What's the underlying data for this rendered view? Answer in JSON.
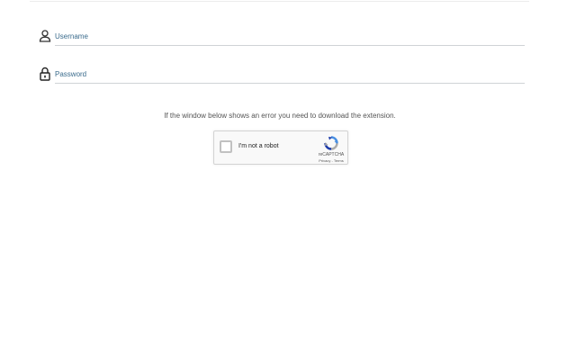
{
  "form": {
    "username": {
      "placeholder": "Username",
      "value": "",
      "icon": "user-icon"
    },
    "password": {
      "placeholder": "Password",
      "value": "",
      "icon": "lock-icon"
    }
  },
  "notice": {
    "text": "If the window below shows an error you need to download the extension."
  },
  "recaptcha": {
    "label": "I'm not a robot",
    "brand": "reCAPTCHA",
    "privacy": "Privacy",
    "separator": " - ",
    "terms": "Terms",
    "checked": false,
    "logo_icon": "recaptcha-logo-icon"
  },
  "colors": {
    "placeholder": "#3a6b8c",
    "underline": "#cfd3d6",
    "recaptcha_blue": "#1c3aa9",
    "recaptcha_lightblue": "#4a90e2",
    "recaptcha_gray": "#ababab"
  }
}
